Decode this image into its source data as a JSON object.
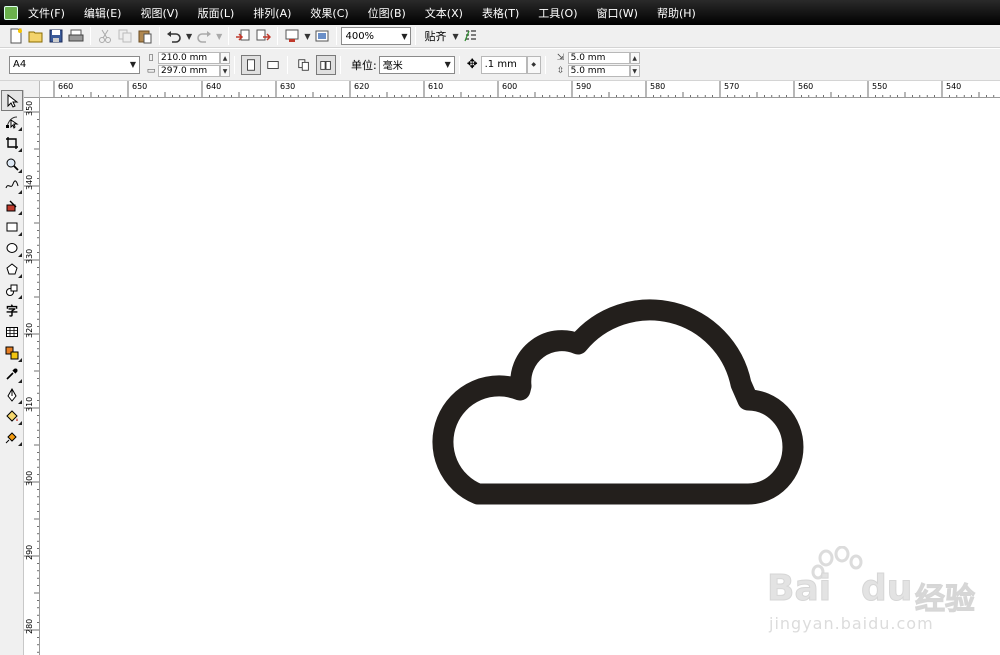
{
  "menu": {
    "items": [
      "文件(F)",
      "编辑(E)",
      "视图(V)",
      "版面(L)",
      "排列(A)",
      "效果(C)",
      "位图(B)",
      "文本(X)",
      "表格(T)",
      "工具(O)",
      "窗口(W)",
      "帮助(H)"
    ]
  },
  "toolbar1": {
    "zoom": "400%",
    "snap_label": "贴齐"
  },
  "toolbar2": {
    "paper_size": "A4",
    "width": "210.0 mm",
    "height": "297.0 mm",
    "unit_label": "单位:",
    "unit_value": "毫米",
    "nudge": ".1 mm",
    "dup_x": "5.0 mm",
    "dup_y": "5.0 mm"
  },
  "rulers": {
    "horizontal": [
      "660",
      "650",
      "640",
      "630",
      "620",
      "610",
      "600",
      "590",
      "580",
      "570",
      "560",
      "550",
      "540"
    ],
    "vertical": [
      "350",
      "340",
      "330",
      "320",
      "310",
      "300",
      "290",
      "280"
    ]
  },
  "toolbox": {
    "text_tool_glyph": "字"
  },
  "canvas": {
    "shape_color": "#231f1c",
    "background": "#ffffff"
  },
  "watermark": {
    "brand": "Bai",
    "brand2": "du",
    "cn": "经验",
    "url": "jingyan.baidu.com"
  }
}
